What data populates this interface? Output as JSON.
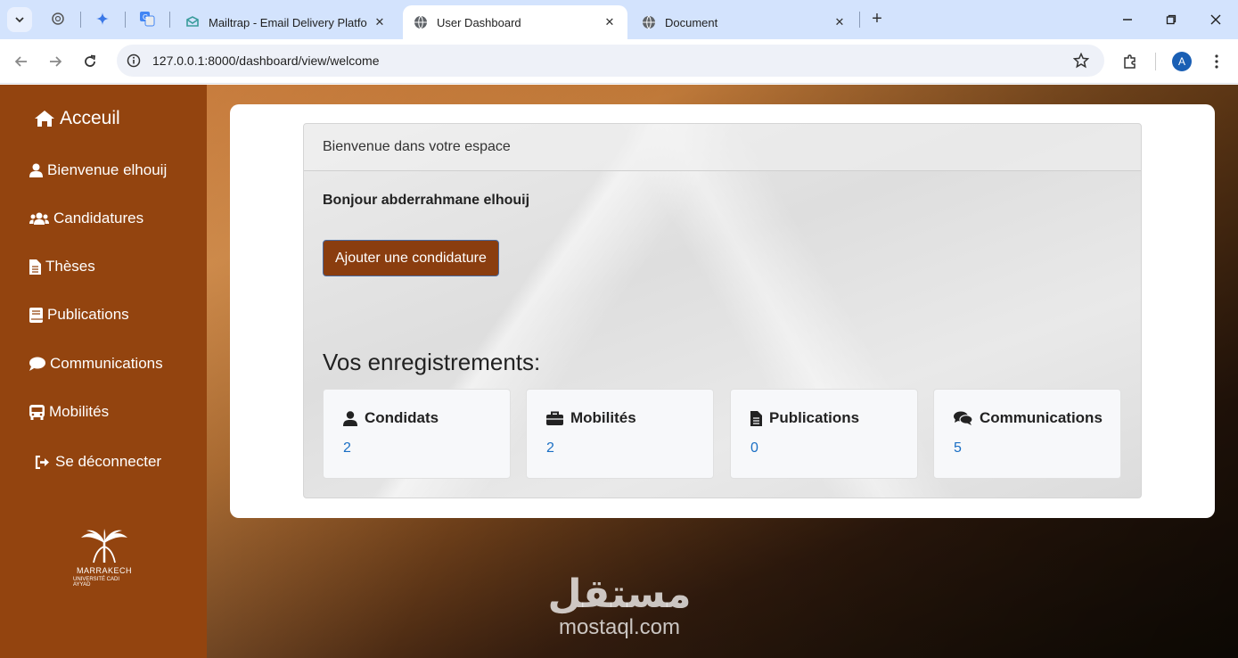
{
  "browser": {
    "tabs": [
      {
        "title": "Mailtrap - Email Delivery Platform",
        "active": false
      },
      {
        "title": "User Dashboard",
        "active": true
      },
      {
        "title": "Document",
        "active": false
      }
    ],
    "url": "127.0.0.1:8000/dashboard/view/welcome",
    "profile_initial": "A"
  },
  "sidebar": {
    "home": "Acceuil",
    "items": [
      {
        "label": "Bienvenue elhouij",
        "icon": "user-icon"
      },
      {
        "label": "Candidatures",
        "icon": "users-icon"
      },
      {
        "label": "Thèses",
        "icon": "file-icon"
      },
      {
        "label": "Publications",
        "icon": "book-icon"
      },
      {
        "label": "Communications",
        "icon": "comment-icon"
      },
      {
        "label": "Mobilités",
        "icon": "bus-icon"
      }
    ],
    "logout": "Se déconnecter",
    "logo_text": "MARRAKECH",
    "logo_sub": "UNIVERSITÉ CADI AYYAD"
  },
  "main": {
    "panel_title": "Bienvenue dans votre espace",
    "greeting": "Bonjour abderrahmane elhouij",
    "add_button": "Ajouter une condidature",
    "records_title": "Vos enregistrements:",
    "stats": [
      {
        "label": "Condidats",
        "value": "2",
        "icon": "user-icon"
      },
      {
        "label": "Mobilités",
        "value": "2",
        "icon": "briefcase-icon"
      },
      {
        "label": "Publications",
        "value": "0",
        "icon": "file-icon"
      },
      {
        "label": "Communications",
        "value": "5",
        "icon": "comments-icon"
      }
    ]
  },
  "watermark": {
    "arabic": "مستقل",
    "latin": "mostaql.com"
  },
  "colors": {
    "sidebar": "#93440f",
    "button": "#8a3d0f",
    "link": "#1a6fc4",
    "tabbar": "#d3e3fd"
  }
}
